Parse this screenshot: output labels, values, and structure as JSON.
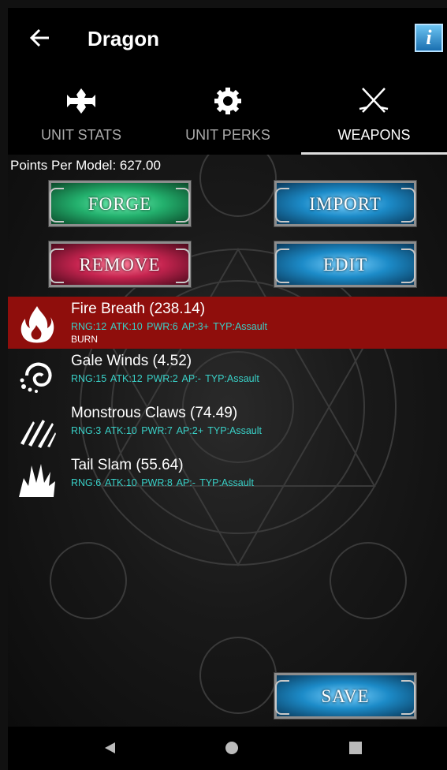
{
  "header": {
    "title": "Dragon",
    "info_label": "i"
  },
  "tabs": [
    {
      "label": "UNIT STATS",
      "icon": "cross-icon",
      "active": false
    },
    {
      "label": "UNIT PERKS",
      "icon": "gear-icon",
      "active": false
    },
    {
      "label": "WEAPONS",
      "icon": "crossed-swords-icon",
      "active": true
    }
  ],
  "points_per_model": "Points Per Model: 627.00",
  "actions": {
    "forge": "FORGE",
    "import": "IMPORT",
    "remove": "REMOVE",
    "edit": "EDIT",
    "save": "SAVE"
  },
  "weapons": [
    {
      "name": "Fire Breath (238.14)",
      "stats": "RNG:12  ATK:10  PWR:6  AP:3+  TYP:Assault",
      "tag": "BURN",
      "icon": "flame-icon",
      "selected": true
    },
    {
      "name": "Gale Winds (4.52)",
      "stats": "RNG:15  ATK:12  PWR:2  AP:-  TYP:Assault",
      "tag": "",
      "icon": "wind-spiral-icon",
      "selected": false
    },
    {
      "name": "Monstrous Claws (74.49)",
      "stats": "RNG:3  ATK:10  PWR:7  AP:2+  TYP:Assault",
      "tag": "",
      "icon": "claw-marks-icon",
      "selected": false
    },
    {
      "name": "Tail Slam (55.64)",
      "stats": "RNG:6  ATK:10  PWR:8  AP:-  TYP:Assault",
      "tag": "",
      "icon": "impact-icon",
      "selected": false
    }
  ],
  "colors": {
    "selected_row": "#8f0e0c",
    "stats_text": "#39d0c7",
    "forge": "#23b06d",
    "remove": "#c5244f",
    "blue_buttons": "#1c8bc8"
  }
}
